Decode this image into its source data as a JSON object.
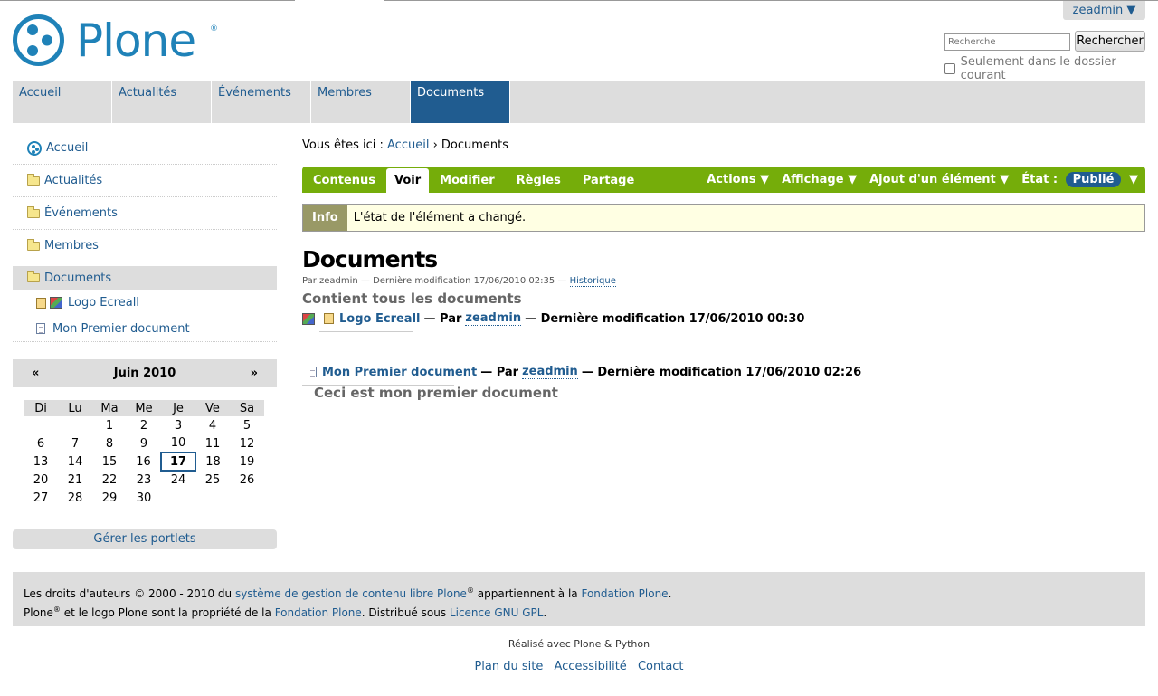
{
  "user": {
    "menu_label": "zeadmin ▼"
  },
  "logo": {
    "text": "Plone",
    "reg": "®"
  },
  "search": {
    "placeholder": "Recherche",
    "button": "Rechercher",
    "checkbox_label": "Seulement dans le dossier courant"
  },
  "globalnav": {
    "tabs": [
      "Accueil",
      "Actualités",
      "Événements",
      "Membres",
      "Documents"
    ]
  },
  "navigation": {
    "items": [
      "Accueil",
      "Actualités",
      "Événements",
      "Membres",
      "Documents"
    ],
    "sub": [
      "Logo Ecreall",
      "Mon Premier document"
    ]
  },
  "calendar": {
    "prev": "«",
    "next": "»",
    "month": "Juin 2010",
    "days": [
      "Di",
      "Lu",
      "Ma",
      "Me",
      "Je",
      "Ve",
      "Sa"
    ],
    "weeks": [
      [
        "",
        "",
        "1",
        "2",
        "3",
        "4",
        "5"
      ],
      [
        "6",
        "7",
        "8",
        "9",
        "10",
        "11",
        "12"
      ],
      [
        "13",
        "14",
        "15",
        "16",
        "17",
        "18",
        "19"
      ],
      [
        "20",
        "21",
        "22",
        "23",
        "24",
        "25",
        "26"
      ],
      [
        "27",
        "28",
        "29",
        "30",
        "",
        "",
        ""
      ]
    ],
    "today": "17"
  },
  "manage_portlets": "Gérer les portlets",
  "breadcrumb": {
    "prefix": "Vous êtes ici :",
    "home": "Accueil",
    "sep": "›",
    "current": "Documents"
  },
  "editbar": {
    "tabs": [
      "Contenus",
      "Voir",
      "Modifier",
      "Règles",
      "Partage"
    ],
    "actions": "Actions ▼",
    "display": "Affichage ▼",
    "add": "Ajout d'un élément ▼",
    "state_label": "État :",
    "state_value": "Publié",
    "state_arrow": "▼"
  },
  "info": {
    "label": "Info",
    "text": "L'état de l'élément a changé."
  },
  "document": {
    "title": "Documents",
    "byline_prefix": "Par zeadmin — Dernière modification 17/06/2010 02:35 —",
    "history": "Historique",
    "description": "Contient tous les documents"
  },
  "listing": [
    {
      "title": "Logo Ecreall",
      "by": "— Par",
      "author": "zeadmin",
      "modified": "— Dernière modification 17/06/2010 00:30"
    },
    {
      "title": "Mon Premier document",
      "by": "— Par",
      "author": "zeadmin",
      "modified": "— Dernière modification 17/06/2010 02:26",
      "description": "Ceci est mon premier document"
    }
  ],
  "footer": {
    "l1a": "Les droits d'auteurs © 2000 - 2010 du",
    "l1link": "système de gestion de contenu libre Plone",
    "l1b": "appartiennent à la",
    "l1link2": "Fondation Plone",
    "l1c": ".",
    "l2a": "Plone",
    "l2b": "et le logo Plone sont la propriété de la",
    "l2link": "Fondation Plone",
    "l2c": ". Distribué sous",
    "l2link2": "Licence GNU GPL",
    "l2d": ".",
    "reg": "®"
  },
  "colophon": "Réalisé avec Plone & Python",
  "siteactions": [
    "Plan du site",
    "Accessibilité",
    "Contact"
  ]
}
